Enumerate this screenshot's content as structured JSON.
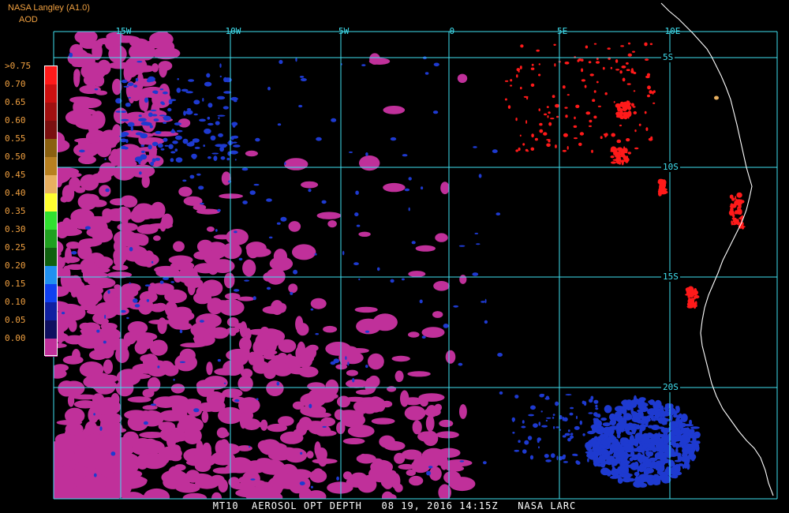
{
  "header": {
    "source": "NASA Langley (A1.0)",
    "variable": "AOD"
  },
  "caption": "MT10  AEROSOL OPT DEPTH   08 19, 2016 14:15Z   NASA LARC",
  "map": {
    "lon_labels": [
      "15W",
      "10W",
      "5W",
      "0",
      "5E",
      "10E"
    ],
    "lat_labels": [
      "5S",
      "10S",
      "15S",
      "20S"
    ],
    "grid_color": "#40e0f0",
    "coast_color": "#ffffff",
    "label_color": "#40e0f0"
  },
  "legend": {
    "labels": [
      ">0.75",
      "0.70",
      "0.65",
      "0.60",
      "0.55",
      "0.50",
      "0.45",
      "0.40",
      "0.35",
      "0.30",
      "0.25",
      "0.20",
      "0.15",
      "0.10",
      "0.05",
      "0.00"
    ],
    "colors": [
      "#ff1a1a",
      "#cc1010",
      "#a01010",
      "#7a1010",
      "#8a6010",
      "#b88020",
      "#e8b060",
      "#ffff30",
      "#30e030",
      "#20a020",
      "#106010",
      "#2090f0",
      "#1040f0",
      "#1020a0",
      "#101060",
      "#c0309a"
    ]
  },
  "colors": {
    "header": "#f0a040",
    "caption": "#ffffff",
    "low_aod_magenta": "#c0309a",
    "blue": "#1e3ad0",
    "red": "#ff1a1a"
  }
}
